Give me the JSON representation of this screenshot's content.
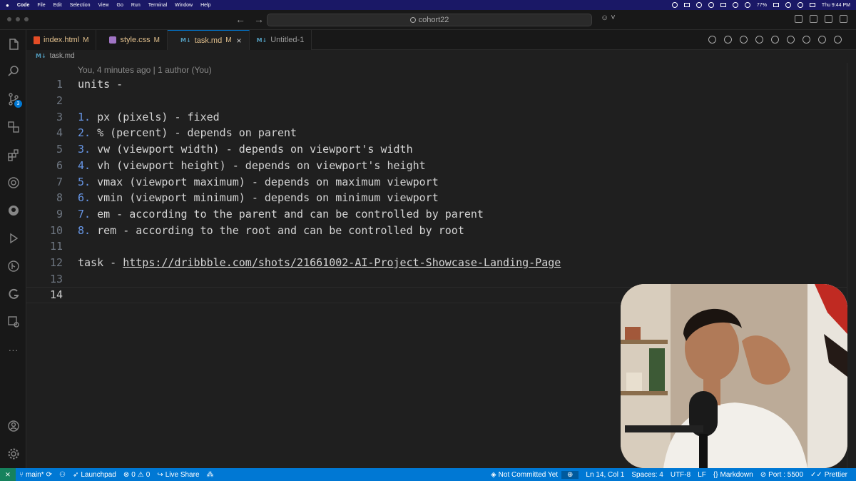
{
  "menubar": {
    "app_name": "Code",
    "items": [
      "File",
      "Edit",
      "Selection",
      "View",
      "Go",
      "Run",
      "Terminal",
      "Window",
      "Help"
    ],
    "battery": "77%",
    "clock": "Thu 9:44 PM"
  },
  "titlebar": {
    "search_text": "cohort22"
  },
  "activity_bar": {
    "source_control_badge": "3"
  },
  "tabs": [
    {
      "label": "index.html",
      "status": "M"
    },
    {
      "label": "style.css",
      "status": "M"
    },
    {
      "label": "task.md",
      "status": "M"
    },
    {
      "label": "Untitled-1",
      "status": ""
    }
  ],
  "breadcrumb": {
    "file": "task.md"
  },
  "editor": {
    "blame": "You, 4 minutes ago | 1 author (You)",
    "lines": [
      {
        "n": "1",
        "marker": "",
        "text": "units -"
      },
      {
        "n": "2",
        "marker": "",
        "text": ""
      },
      {
        "n": "3",
        "marker": "1.",
        "text": " px (pixels) - fixed"
      },
      {
        "n": "4",
        "marker": "2.",
        "text": " % (percent) - depends on parent"
      },
      {
        "n": "5",
        "marker": "3.",
        "text": " vw (viewport width) - depends on viewport's width"
      },
      {
        "n": "6",
        "marker": "4.",
        "text": " vh (viewport height) - depends on viewport's height"
      },
      {
        "n": "7",
        "marker": "5.",
        "text": " vmax (viewport maximum) - depends on maximum viewport"
      },
      {
        "n": "8",
        "marker": "6.",
        "text": " vmin (viewport minimum) - depends on minimum viewport"
      },
      {
        "n": "9",
        "marker": "7.",
        "text": " em - according to the parent and can be controlled by parent"
      },
      {
        "n": "10",
        "marker": "8.",
        "text": " rem - according to the root and can be controlled by root"
      },
      {
        "n": "11",
        "marker": "",
        "text": ""
      },
      {
        "n": "12",
        "marker": "",
        "text": "task - "
      },
      {
        "n": "13",
        "marker": "",
        "text": ""
      },
      {
        "n": "14",
        "marker": "",
        "text": ""
      }
    ],
    "task_link": "https://dribbble.com/shots/21661002-AI-Project-Showcase-Landing-Page"
  },
  "statusbar": {
    "branch": "main*",
    "launchpad": "Launchpad",
    "errors": "0",
    "warnings": "0",
    "live_share": "Live Share",
    "commit_status": "Not Committed Yet",
    "cursor": "Ln 14, Col 1",
    "spaces": "Spaces: 4",
    "encoding": "UTF-8",
    "eol": "LF",
    "language": "Markdown",
    "port": "Port : 5500",
    "prettier": "Prettier"
  },
  "colors": {
    "statusbar": "#0078d4",
    "list_number": "#6796e6",
    "modified_tab": "#e2c08d"
  }
}
